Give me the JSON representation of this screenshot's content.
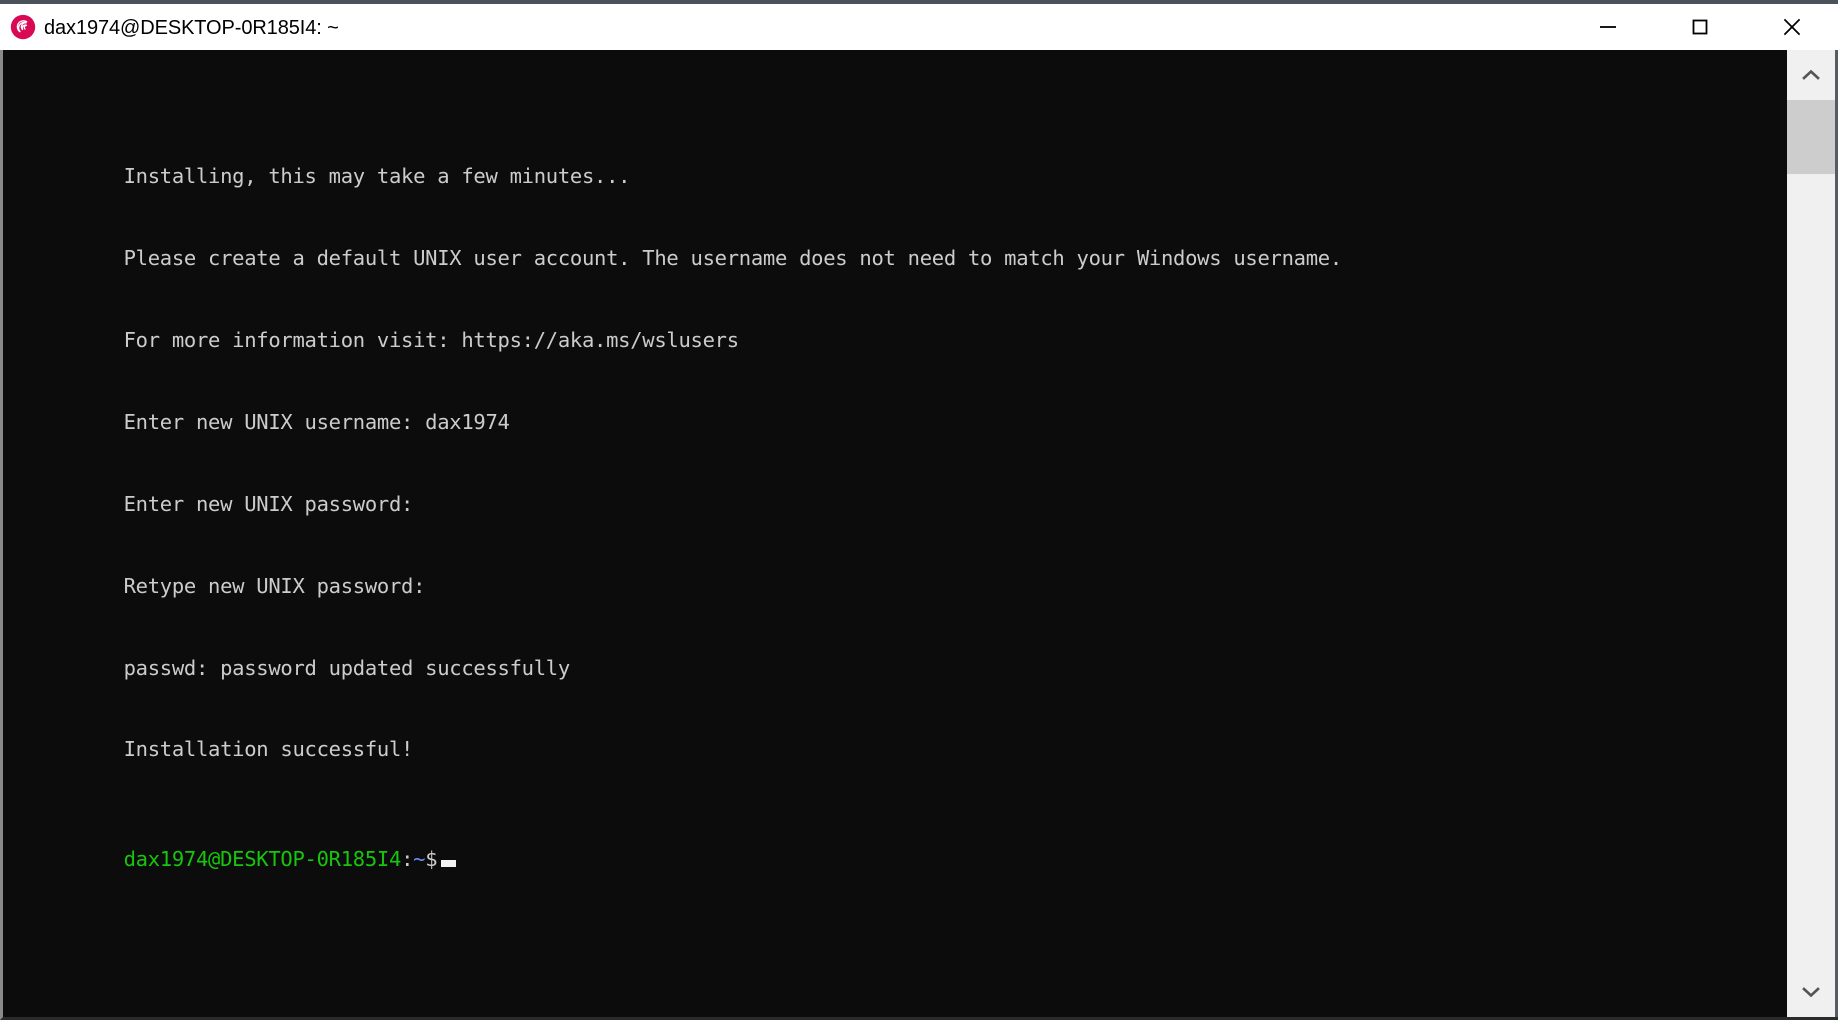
{
  "window": {
    "title": "dax1974@DESKTOP-0R185I4: ~",
    "icon": "debian-logo-icon",
    "accent_color": "#d70a53",
    "controls": {
      "minimize_label": "Minimize",
      "maximize_label": "Maximize",
      "close_label": "Close"
    }
  },
  "terminal": {
    "background_color": "#0c0c0c",
    "foreground_color": "#cccccc",
    "prompt_color": "#16c60c",
    "path_color": "#6a8ef5",
    "lines": [
      "Installing, this may take a few minutes...",
      "Please create a default UNIX user account. The username does not need to match your Windows username.",
      "For more information visit: https://aka.ms/wslusers",
      "Enter new UNIX username: dax1974",
      "Enter new UNIX password:",
      "Retype new UNIX password:",
      "passwd: password updated successfully",
      "Installation successful!"
    ],
    "prompt": {
      "user_host": "dax1974@DESKTOP-0R185I4",
      "separator": ":",
      "path": "~",
      "symbol": "$",
      "input_value": ""
    }
  },
  "scrollbar": {
    "up_arrow_label": "Scroll up",
    "down_arrow_label": "Scroll down",
    "thumb_position_percent": 0,
    "track_color": "#f0f0f0",
    "thumb_color": "#cdcdcd"
  }
}
